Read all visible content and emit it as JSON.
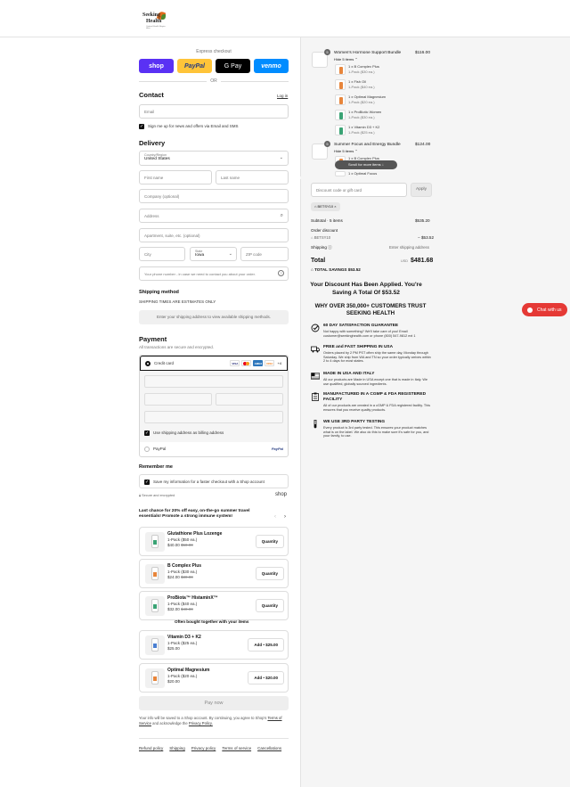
{
  "brand": {
    "name_line1": "Seeking",
    "name_line2": "Health",
    "tagline": "Optimal Health Begins Here"
  },
  "express": {
    "label": "Express checkout",
    "buttons": [
      "shop",
      "PayPal",
      "G Pay",
      "venmo"
    ],
    "or": "OR"
  },
  "contact": {
    "title": "Contact",
    "login": "Log in",
    "email_placeholder": "Email",
    "news_label": "Sign me up for news and offers via Email and SMS"
  },
  "delivery": {
    "title": "Delivery",
    "country_label": "Country/Region",
    "country_value": "United States",
    "first_name": "First name",
    "last_name": "Last name",
    "company": "Company (optional)",
    "address": "Address",
    "apartment": "Apartment, suite, etc. (optional)",
    "city": "City",
    "state_label": "State",
    "state_value": "Iowa",
    "zip": "ZIP code",
    "phone": "Your phone number - in case we need to contact you about your order."
  },
  "shipping_method": {
    "title": "Shipping method",
    "note": "SHIPPING TIMES ARE ESTIMATES ONLY",
    "placeholder": "Enter your shipping address to view available shipping methods."
  },
  "payment": {
    "title": "Payment",
    "subtitle": "All transactions are secure and encrypted.",
    "credit_card": "Credit card",
    "cards": [
      "VISA",
      "MC",
      "AMEX",
      "DISC"
    ],
    "more_cards": "+4",
    "billing_same": "Use shipping address as billing address",
    "paypal": "PayPal"
  },
  "remember": {
    "title": "Remember me",
    "label": "Save my information for a faster checkout with a Shop account",
    "secure": "Secure and encrypted",
    "shop": "shop"
  },
  "upsell": {
    "heading": "Last chance for 20% off easy, on-the-go summer travel essentials! Promote a strong immune system!",
    "items": [
      {
        "name": "Glutathione Plus Lozenge",
        "pack": "1-Pack ($50 ea.)",
        "price": "$40.00",
        "old": "$50.00",
        "btn": "Quantity",
        "color": "#3aa374"
      },
      {
        "name": "B Complex Plus",
        "pack": "1-Pack ($30 ea.)",
        "price": "$24.00",
        "old": "$30.00",
        "btn": "Quantity",
        "color": "#e7853b"
      },
      {
        "name": "ProBiota™ HistaminX™",
        "pack": "1-Pack ($40 ea.)",
        "price": "$32.00",
        "old": "$40.00",
        "btn": "Quantity",
        "color": "#3aa374"
      }
    ],
    "together": "Often bought together with your items",
    "addons": [
      {
        "name": "Vitamin D3 + K2",
        "pack": "1-Pack ($25 ea.)",
        "price": "$25.00",
        "btn": "Add • $25.00",
        "color": "#4a7fd1"
      },
      {
        "name": "Optimal Magnesium",
        "pack": "1-Pack ($20 ea.)",
        "price": "$20.00",
        "btn": "Add • $20.00",
        "color": "#e7853b"
      }
    ]
  },
  "pay_now": "Pay now",
  "legal": {
    "text1": "Your info will be saved to a Shop account. By continuing, you agree to Shop's",
    "terms": "Terms of Service",
    "and": "and acknowledge the",
    "privacy": "Privacy Policy."
  },
  "footer": [
    "Refund policy",
    "Shipping",
    "Privacy policy",
    "Terms of service",
    "Cancellations"
  ],
  "summary": {
    "bundle1": {
      "qty": "5",
      "name": "Women's Hormone Support Bundle",
      "price": "$116.00",
      "toggle": "Hide 5 items",
      "items": [
        {
          "t": "1 x B Complex Plus",
          "s": "1-Pack ($30 ea.)",
          "c": "#e7853b"
        },
        {
          "t": "1 x Fish Oil",
          "s": "1-Pack ($40 ea.)",
          "c": "#e7853b"
        },
        {
          "t": "1 x Optimal Magnesium",
          "s": "1-Pack ($20 ea.)",
          "c": "#e7853b"
        },
        {
          "t": "1 x ProBiotic Women",
          "s": "1-Pack ($30 ea.)",
          "c": "#3aa374"
        },
        {
          "t": "1 x Vitamin D3 + K2",
          "s": "1-Pack ($25 ea.)",
          "c": "#3aa374"
        }
      ]
    },
    "bundle2": {
      "qty": "5",
      "name": "Summer Focus and Energy Bundle",
      "price": "$124.00",
      "toggle": "Hide 5 items",
      "items": [
        {
          "t": "1 x B Complex Plus",
          "s": "",
          "c": "#e7853b"
        },
        {
          "t": "1 x Optimal Focus",
          "s": "",
          "c": "#e7853b"
        }
      ]
    },
    "scroll_hint": "Scroll for more items",
    "discount_placeholder": "Discount code or gift card",
    "apply": "Apply",
    "code": "BETSY10",
    "subtotal_label": "Subtotal · 5 items",
    "subtotal": "$535.20",
    "order_discount": "Order discount",
    "discount_code": "BETSY10",
    "discount_amount": "− $53.52",
    "shipping_label": "Shipping",
    "shipping_value": "Enter shipping address",
    "total_label": "Total",
    "currency": "USD",
    "total": "$481.68",
    "savings_label": "TOTAL SAVINGS",
    "savings": "$53.52"
  },
  "promo": {
    "line1": "Your Discount Has Been Applied. You're",
    "line2": "Saving A Total Of $53.52",
    "trust1": "WHY OVER 350,000+ CUSTOMERS TRUST",
    "trust2": "SEEKING HEALTH"
  },
  "trust": [
    {
      "title": "60 DAY SATISFACTION GUARANTEE",
      "desc": "Not happy with something? We'll take care of you! Email customer@seekinghealth.com or phone (800) 547-9812 ext 1"
    },
    {
      "title": "FREE and FAST SHIPPING IN USA",
      "desc": "Orders placed by 2 PM PST often ship the same day, Monday through Saturday. We ship from WA and TN so your order typically arrives within 2 to 4 days for most states."
    },
    {
      "title": "MADE IN USA AND ITALY",
      "desc": "All our products are Made in USA except one that is made in Italy. We use qualified, globally sourced ingredients."
    },
    {
      "title": "MANUFACTURED IN A CGMP & FDA REGISTERED FACILITY",
      "desc": "All of our products are created in a cGMP & FDA registered facility. This ensures that you receive quality products."
    },
    {
      "title": "WE USE 3RD PARTY TESTING",
      "desc": "Every product is 3rd party tested. This ensures your product matches what is on the label. We also do this to make sure it's safe for you, and your family, to use."
    }
  ],
  "chat": "Chat with us"
}
